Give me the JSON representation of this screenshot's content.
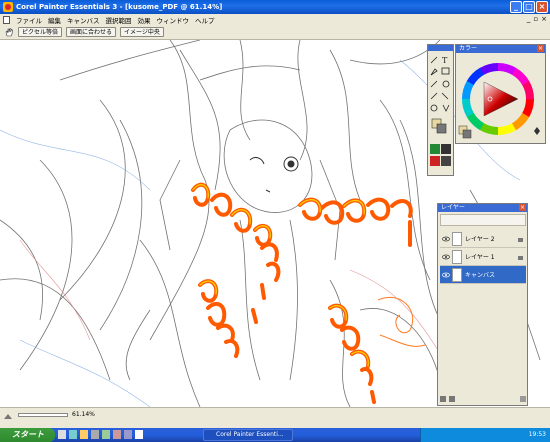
{
  "window": {
    "title": "Corel Painter Essentials 3 - [kusome_PDF @ 61.14%]",
    "controls": [
      "minimize",
      "maximize",
      "close"
    ]
  },
  "menu": {
    "items": [
      "ファイル",
      "編集",
      "キャンバス",
      "選択範囲",
      "効果",
      "ウィンドウ",
      "ヘルプ"
    ],
    "file_icon": "document-icon"
  },
  "toolbar": {
    "buttons": [
      "ピクセル等倍",
      "画面に合わせる",
      "イメージ中央"
    ]
  },
  "color_panel": {
    "title": "カラー"
  },
  "layer_panel": {
    "title": "レイヤー",
    "layers": [
      {
        "name": "レイヤー 2",
        "selected": false
      },
      {
        "name": "レイヤー 1",
        "selected": false
      },
      {
        "name": "キャンバス",
        "selected": true
      }
    ]
  },
  "status": {
    "zoom": "61.14%"
  },
  "taskbar": {
    "start_label": "スタート",
    "task_label": "Corel Painter Essenti...",
    "clock": "19:53"
  },
  "colors": {
    "accent": "#3169c6",
    "stroke_orange": "#ff5a00",
    "stroke_yellow": "#ffcc00"
  }
}
